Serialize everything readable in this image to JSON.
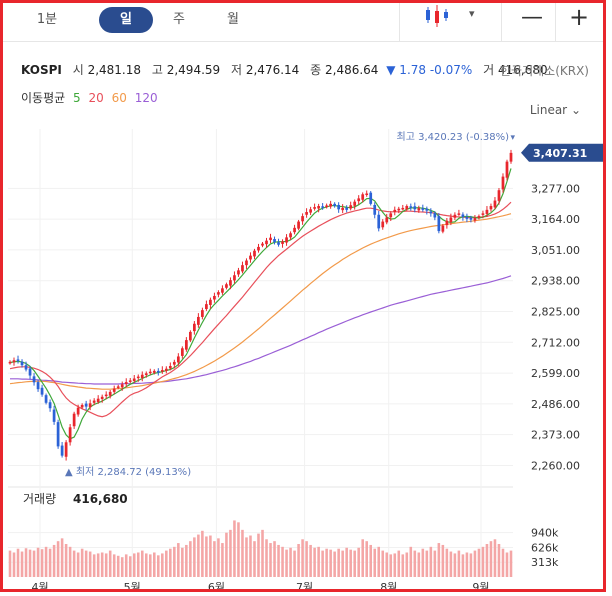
{
  "toolbar": {
    "tabs": [
      "1분",
      "일",
      "주",
      "월"
    ],
    "active_tab": "일",
    "interval_caret": "▾",
    "zoom_out": "—",
    "zoom_in": "+"
  },
  "quote": {
    "symbol": "KOSPI",
    "open_label": "시",
    "open": "2,481.18",
    "high_label": "고",
    "high": "2,494.59",
    "low_label": "저",
    "low": "2,476.14",
    "close_label": "종",
    "close": "2,486.64",
    "change": "▼ 1.78 -0.07%",
    "volume_label": "거",
    "volume": "416,680",
    "exchange": "한국거래소(KRX)"
  },
  "moving_average": {
    "label": "이동평균",
    "periods": [
      "5",
      "20",
      "60",
      "120"
    ],
    "colors": [
      "#3fa83a",
      "#e8505b",
      "#f29a4a",
      "#9a5fd6"
    ]
  },
  "scale_mode": "Linear",
  "colors": {
    "up": "#e8262c",
    "down": "#2b62d6",
    "volume": "#f4a6a6",
    "price_tag": "#2a4c8f",
    "border": "#e8262c"
  },
  "chart_data": {
    "type": "candlestick",
    "x_tick_labels": [
      "4월",
      "5월",
      "6월",
      "7월",
      "8월",
      "9월"
    ],
    "y_tick_labels": [
      "2,260.00",
      "2,373.00",
      "2,486.00",
      "2,599.00",
      "2,712.00",
      "2,825.00",
      "2,938.00",
      "3,051.00",
      "3,164.00",
      "3,277.00"
    ],
    "ylim": [
      2225,
      3480
    ],
    "current_price": "3,407.31",
    "max_label": "최고 3,420.23 (-0.38%)",
    "min_label": "▲ 최저 2,284.72 (49.13%)",
    "volume_label": "거래량",
    "volume_value": "416,680",
    "volume_ticks": [
      "313k",
      "626k",
      "940k"
    ],
    "volume_ylim": [
      0,
      1400
    ],
    "month_starts": [
      0,
      23,
      44,
      66,
      87,
      110
    ],
    "close": [
      2640,
      2646,
      2645,
      2628,
      2612,
      2590,
      2565,
      2540,
      2520,
      2490,
      2470,
      2420,
      2330,
      2296,
      2345,
      2400,
      2450,
      2472,
      2482,
      2476,
      2488,
      2498,
      2505,
      2512,
      2520,
      2530,
      2542,
      2550,
      2558,
      2566,
      2572,
      2579,
      2586,
      2593,
      2598,
      2604,
      2607,
      2603,
      2610,
      2615,
      2625,
      2640,
      2660,
      2690,
      2720,
      2750,
      2780,
      2805,
      2830,
      2852,
      2868,
      2882,
      2896,
      2910,
      2925,
      2940,
      2958,
      2976,
      2995,
      3012,
      3030,
      3048,
      3062,
      3074,
      3085,
      3096,
      3080,
      3070,
      3082,
      3097,
      3112,
      3132,
      3155,
      3175,
      3190,
      3200,
      3208,
      3212,
      3210,
      3214,
      3220,
      3212,
      3200,
      3205,
      3198,
      3215,
      3228,
      3240,
      3255,
      3258,
      3220,
      3180,
      3130,
      3155,
      3170,
      3185,
      3198,
      3202,
      3205,
      3212,
      3208,
      3200,
      3204,
      3198,
      3195,
      3185,
      3170,
      3120,
      3140,
      3158,
      3170,
      3180,
      3185,
      3172,
      3165,
      3162,
      3168,
      3175,
      3185,
      3198,
      3212,
      3232,
      3270,
      3320,
      3375,
      3407
    ],
    "ma5": [
      2638,
      2640,
      2642,
      2640,
      2634,
      2624,
      2608,
      2587,
      2565,
      2543,
      2517,
      2488,
      2446,
      2401,
      2372,
      2358,
      2364,
      2392,
      2430,
      2456,
      2474,
      2484,
      2490,
      2496,
      2505,
      2513,
      2522,
      2531,
      2540,
      2549,
      2558,
      2565,
      2572,
      2579,
      2586,
      2592,
      2598,
      2601,
      2604,
      2608,
      2612,
      2619,
      2630,
      2648,
      2667,
      2697,
      2728,
      2757,
      2785,
      2811,
      2834,
      2851,
      2866,
      2882,
      2896,
      2911,
      2926,
      2942,
      2959,
      2977,
      2994,
      3012,
      3029,
      3045,
      3060,
      3073,
      3079,
      3081,
      3081,
      3082,
      3088,
      3098,
      3116,
      3134,
      3153,
      3170,
      3186,
      3197,
      3204,
      3209,
      3213,
      3214,
      3211,
      3210,
      3207,
      3206,
      3209,
      3217,
      3227,
      3239,
      3240,
      3231,
      3209,
      3189,
      3171,
      3164,
      3166,
      3178,
      3192,
      3200,
      3205,
      3205,
      3206,
      3204,
      3201,
      3196,
      3190,
      3174,
      3162,
      3154,
      3152,
      3154,
      3167,
      3173,
      3174,
      3173,
      3170,
      3168,
      3171,
      3178,
      3187,
      3201,
      3223,
      3257,
      3302,
      3350
    ],
    "ma20": [
      2615,
      2618,
      2621,
      2622,
      2622,
      2620,
      2617,
      2612,
      2605,
      2596,
      2584,
      2569,
      2550,
      2527,
      2508,
      2494,
      2484,
      2476,
      2468,
      2462,
      2455,
      2448,
      2442,
      2439,
      2443,
      2452,
      2465,
      2479,
      2493,
      2506,
      2518,
      2525,
      2530,
      2537,
      2545,
      2555,
      2565,
      2575,
      2585,
      2593,
      2601,
      2611,
      2622,
      2635,
      2649,
      2663,
      2679,
      2695,
      2711,
      2728,
      2745,
      2762,
      2778,
      2794,
      2810,
      2827,
      2844,
      2861,
      2878,
      2896,
      2914,
      2932,
      2950,
      2968,
      2986,
      3002,
      3016,
      3030,
      3042,
      3054,
      3066,
      3078,
      3090,
      3101,
      3111,
      3120,
      3129,
      3138,
      3146,
      3154,
      3162,
      3169,
      3175,
      3181,
      3186,
      3190,
      3194,
      3197,
      3201,
      3204,
      3204,
      3202,
      3197,
      3194,
      3192,
      3191,
      3191,
      3191,
      3192,
      3193,
      3193,
      3192,
      3191,
      3190,
      3189,
      3188,
      3186,
      3182,
      3179,
      3177,
      3175,
      3173,
      3172,
      3171,
      3170,
      3170,
      3170,
      3171,
      3172,
      3174,
      3178,
      3183,
      3190,
      3200,
      3212,
      3226
    ],
    "ma60": [
      2560,
      2562,
      2564,
      2565,
      2567,
      2568,
      2569,
      2569,
      2569,
      2568,
      2566,
      2564,
      2561,
      2558,
      2555,
      2552,
      2550,
      2548,
      2546,
      2544,
      2543,
      2542,
      2541,
      2540,
      2540,
      2540,
      2541,
      2542,
      2543,
      2545,
      2547,
      2549,
      2551,
      2553,
      2556,
      2559,
      2562,
      2565,
      2568,
      2571,
      2575,
      2579,
      2583,
      2588,
      2593,
      2599,
      2605,
      2612,
      2619,
      2627,
      2635,
      2643,
      2652,
      2661,
      2671,
      2681,
      2691,
      2702,
      2713,
      2725,
      2737,
      2749,
      2761,
      2774,
      2787,
      2800,
      2812,
      2825,
      2838,
      2851,
      2864,
      2877,
      2890,
      2903,
      2915,
      2928,
      2940,
      2952,
      2964,
      2975,
      2986,
      2996,
      3006,
      3016,
      3025,
      3034,
      3042,
      3050,
      3058,
      3065,
      3072,
      3078,
      3084,
      3090,
      3095,
      3100,
      3105,
      3110,
      3114,
      3118,
      3122,
      3125,
      3128,
      3131,
      3134,
      3137,
      3139,
      3141,
      3143,
      3145,
      3147,
      3149,
      3151,
      3153,
      3154,
      3156,
      3158,
      3160,
      3162,
      3164,
      3167,
      3170,
      3173,
      3176,
      3180,
      3184
    ],
    "ma120": [
      2578,
      2578,
      2578,
      2577,
      2577,
      2576,
      2575,
      2574,
      2573,
      2572,
      2571,
      2570,
      2568,
      2566,
      2565,
      2564,
      2563,
      2562,
      2561,
      2560,
      2560,
      2559,
      2559,
      2559,
      2559,
      2559,
      2559,
      2559,
      2560,
      2560,
      2560,
      2561,
      2561,
      2562,
      2563,
      2564,
      2565,
      2566,
      2567,
      2568,
      2570,
      2572,
      2574,
      2576,
      2578,
      2581,
      2584,
      2587,
      2590,
      2593,
      2597,
      2601,
      2605,
      2609,
      2613,
      2618,
      2622,
      2627,
      2632,
      2637,
      2642,
      2648,
      2653,
      2659,
      2665,
      2671,
      2677,
      2683,
      2689,
      2695,
      2701,
      2708,
      2714,
      2721,
      2727,
      2734,
      2740,
      2747,
      2753,
      2760,
      2766,
      2772,
      2778,
      2784,
      2790,
      2796,
      2802,
      2807,
      2813,
      2818,
      2823,
      2828,
      2833,
      2838,
      2843,
      2848,
      2852,
      2856,
      2860,
      2864,
      2868,
      2872,
      2876,
      2880,
      2884,
      2888,
      2891,
      2894,
      2897,
      2900,
      2903,
      2906,
      2909,
      2912,
      2915,
      2918,
      2921,
      2924,
      2927,
      2930,
      2934,
      2938,
      2942,
      2946,
      2951,
      2956
    ],
    "volume": [
      560,
      520,
      600,
      540,
      610,
      580,
      560,
      620,
      590,
      640,
      600,
      680,
      760,
      820,
      700,
      640,
      560,
      520,
      600,
      560,
      540,
      480,
      500,
      520,
      500,
      560,
      480,
      450,
      420,
      480,
      440,
      500,
      520,
      560,
      500,
      480,
      520,
      460,
      500,
      560,
      600,
      640,
      720,
      620,
      680,
      760,
      840,
      900,
      980,
      860,
      880,
      760,
      820,
      720,
      940,
      1000,
      1200,
      1160,
      1000,
      840,
      880,
      760,
      920,
      1000,
      800,
      720,
      760,
      680,
      640,
      580,
      620,
      560,
      700,
      800,
      760,
      680,
      620,
      640,
      560,
      600,
      580,
      540,
      600,
      560,
      620,
      580,
      560,
      620,
      800,
      760,
      680,
      600,
      640,
      560,
      520,
      480,
      500,
      560,
      480,
      520,
      640,
      560,
      520,
      600,
      560,
      640,
      560,
      720,
      680,
      600,
      540,
      500,
      560,
      480,
      520,
      500,
      560,
      600,
      640,
      700,
      760,
      800,
      700,
      600,
      520,
      560
    ]
  }
}
